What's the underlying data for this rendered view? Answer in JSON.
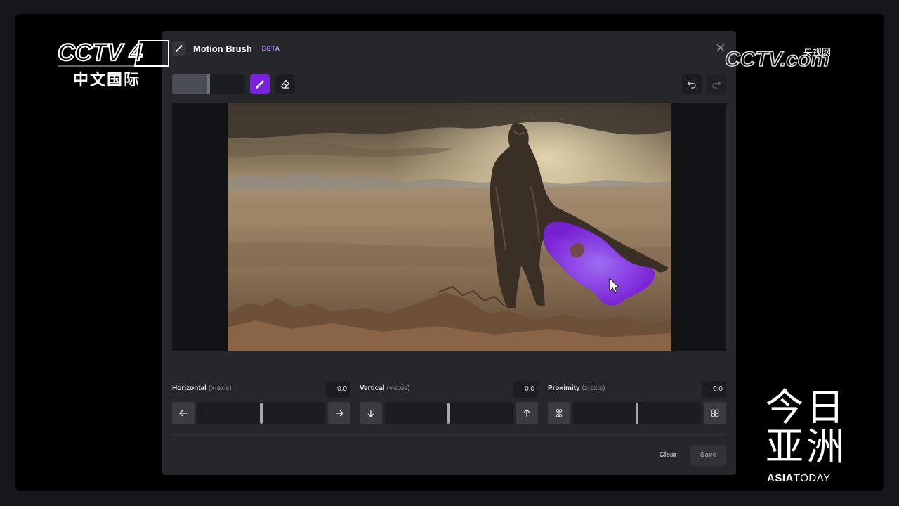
{
  "app": {
    "title": "Motion Brush",
    "badge": "BETA"
  },
  "toolbar": {
    "brush_size": 0.5,
    "brush_icon": "brush-icon",
    "eraser_icon": "eraser-icon",
    "undo_icon": "undo-icon",
    "redo_icon": "redo-icon"
  },
  "controls": [
    {
      "label": "Horizontal",
      "axis": "(x-axis)",
      "value": "0.0",
      "left_icon": "arrow-left-icon",
      "right_icon": "arrow-right-icon",
      "slider_position": 0.5
    },
    {
      "label": "Vertical",
      "axis": "(y-axis)",
      "value": "0.0",
      "left_icon": "arrow-down-icon",
      "right_icon": "arrow-up-icon",
      "slider_position": 0.5
    },
    {
      "label": "Proximity",
      "axis": "(z-axis)",
      "value": "0.0",
      "left_icon": "zoom-out-icon",
      "right_icon": "zoom-in-icon",
      "slider_position": 0.5
    }
  ],
  "actions": {
    "clear": "Clear",
    "save": "Save"
  },
  "overlays": {
    "channel_logo": "CCTV 4",
    "channel_cn": "中文国际",
    "site_logo": "CCTV.com",
    "site_cn": "央视网",
    "program_cn_1": "今日",
    "program_cn_2": "亚洲",
    "program_en_1": "ASIA",
    "program_en_2": "TODAY"
  },
  "colors": {
    "accent": "#7a21e0",
    "mask": "#7b1fe0",
    "panel": "#25272b"
  }
}
